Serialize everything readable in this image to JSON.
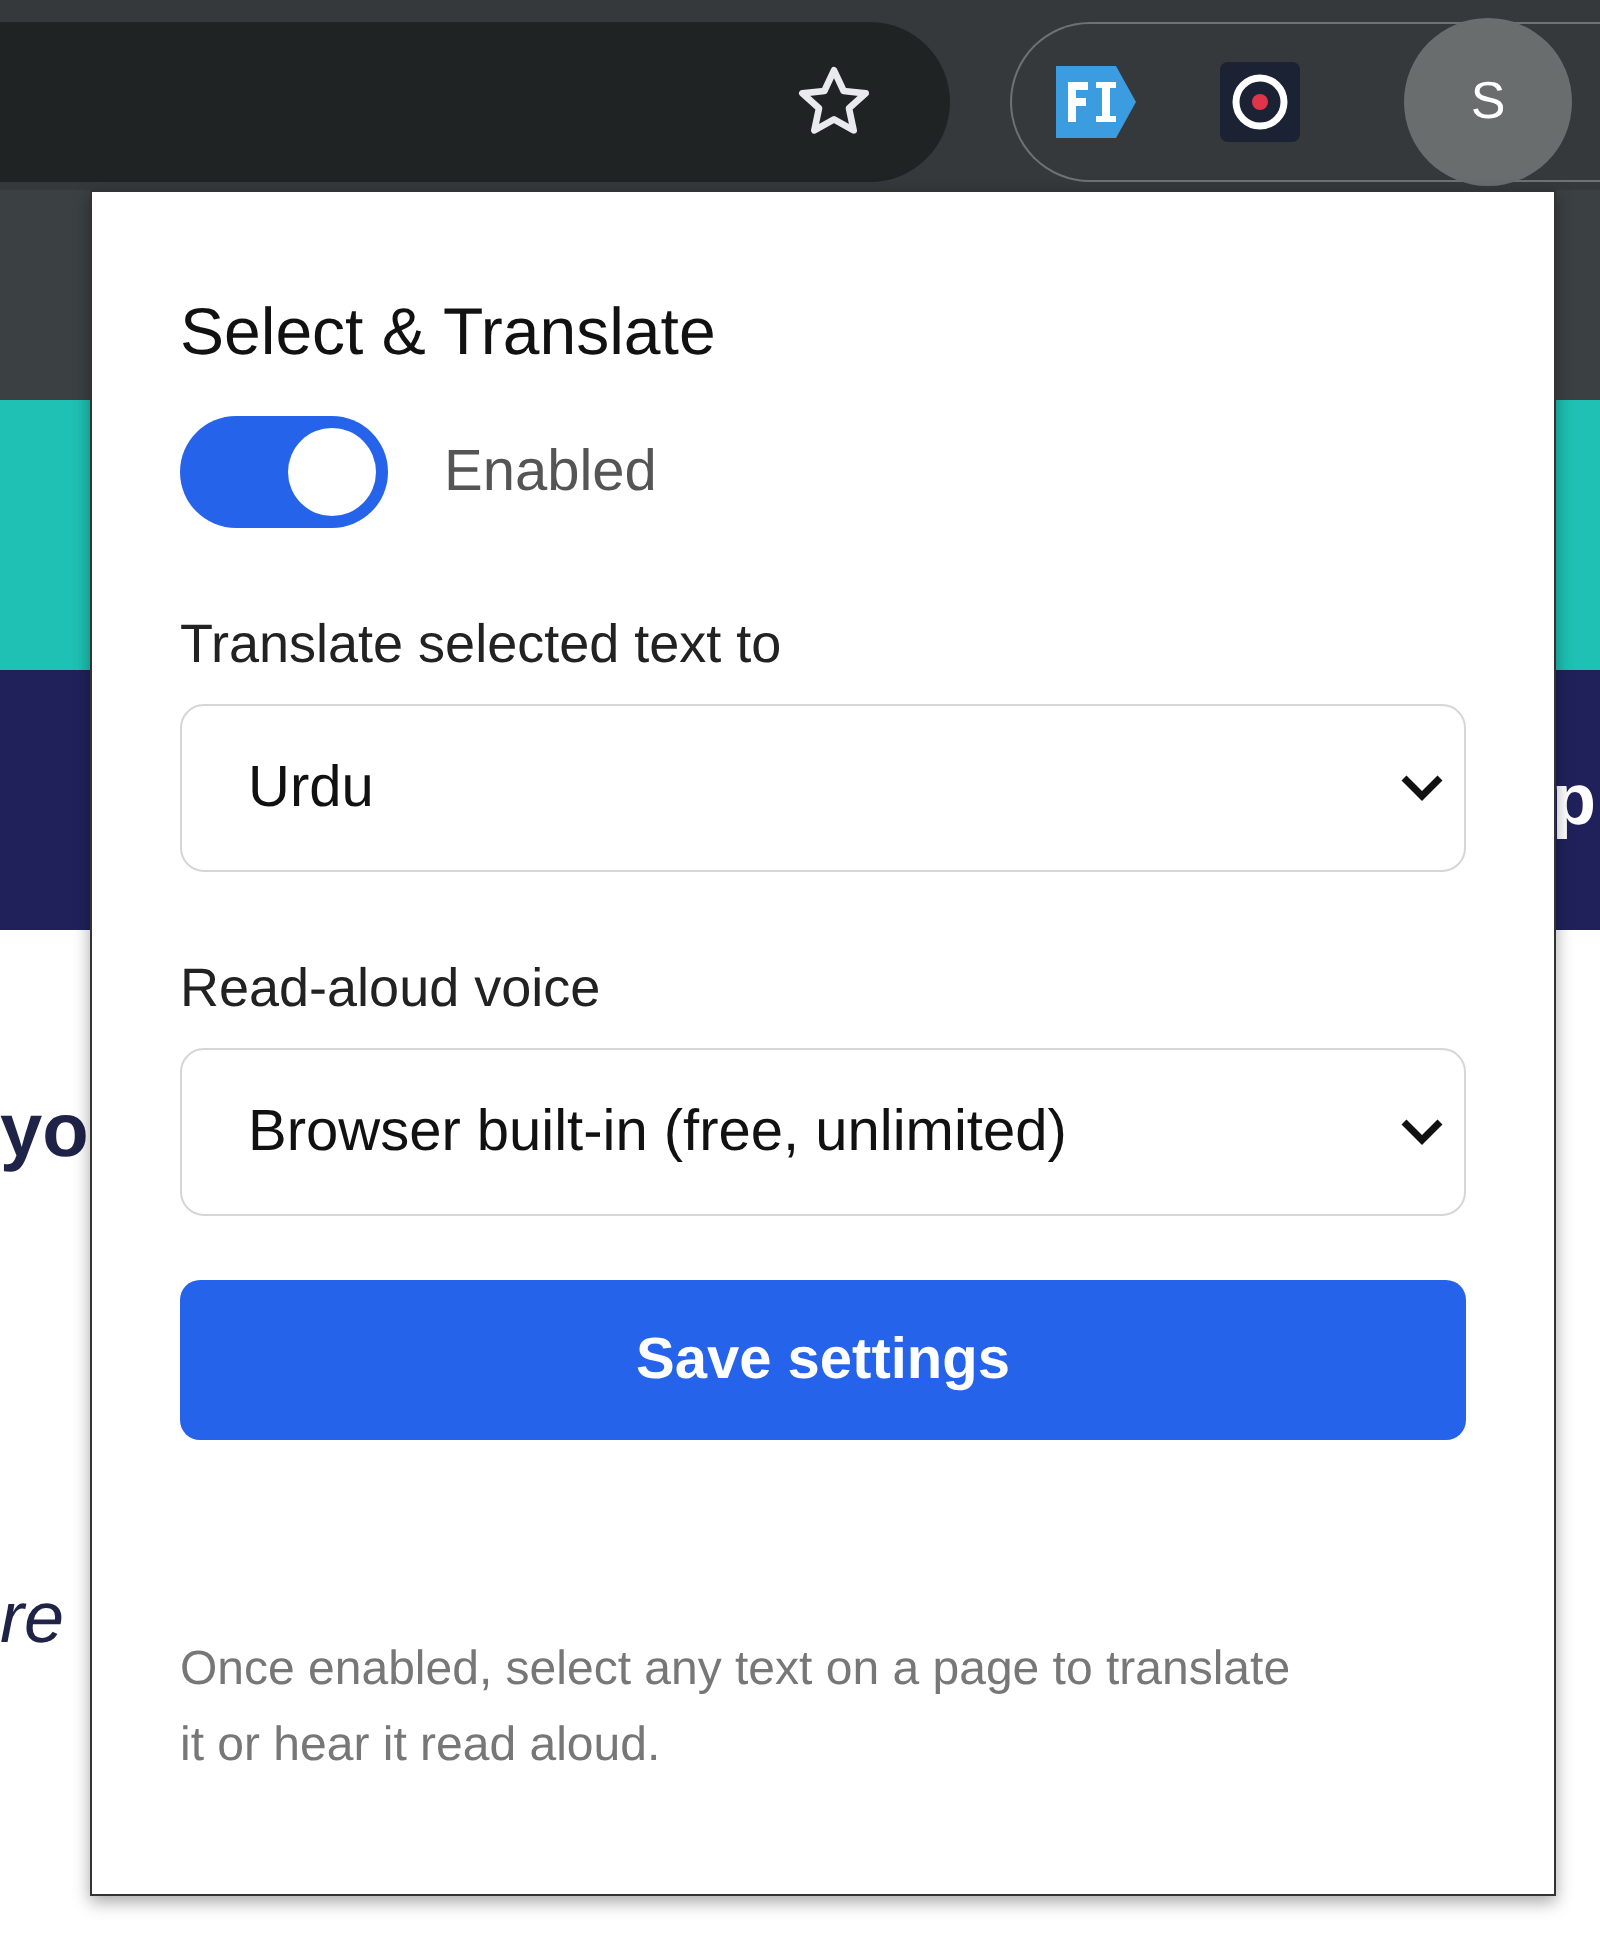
{
  "toolbar": {
    "avatar": "S"
  },
  "page_behind": {
    "fragments": [
      "yo",
      "re",
      "p"
    ]
  },
  "popup": {
    "title": "Select & Translate",
    "toggle": {
      "on": true,
      "label": "Enabled"
    },
    "language": {
      "label": "Translate selected text to",
      "value": "Urdu"
    },
    "voice": {
      "label": "Read-aloud voice",
      "value": "Browser built-in (free, unlimited)"
    },
    "save_button": "Save settings",
    "note": "Once enabled, select any text on a page to translate it or hear it read aloud."
  }
}
